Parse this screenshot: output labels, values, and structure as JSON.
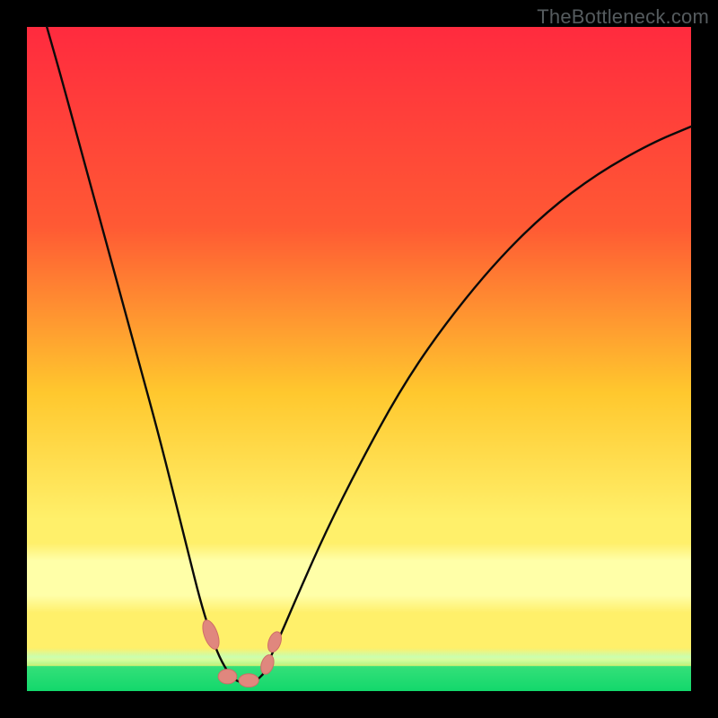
{
  "watermark": "TheBottleneck.com",
  "colors": {
    "black": "#000000",
    "curve": "#0a0a0a",
    "marker_fill": "#e0877e",
    "marker_stroke": "#cf6e67",
    "grad_top": "#ff2b3f",
    "grad_mid1": "#ff7a2e",
    "grad_mid2": "#ffc82e",
    "grad_mid3": "#fff06a",
    "grad_yellow_pale": "#ffffa8",
    "grad_green_pale": "#c8ffb0",
    "grad_green": "#35e07a",
    "grad_green_deep": "#13d86c"
  },
  "chart_data": {
    "type": "line",
    "title": "",
    "xlabel": "",
    "ylabel": "",
    "xlim": [
      0,
      100
    ],
    "ylim": [
      0,
      100
    ],
    "note": "Axes are implied percentage scales; values are read from curve pixel positions over the gradient background.",
    "series": [
      {
        "name": "left-branch",
        "x": [
          3,
          5,
          8,
          11,
          14,
          17,
          20,
          23,
          24.5,
          26,
          27.5,
          29,
          30.5
        ],
        "y": [
          100,
          93,
          82,
          71,
          60,
          49,
          38,
          26,
          20,
          14,
          9,
          5,
          2.5
        ]
      },
      {
        "name": "valley",
        "x": [
          30.5,
          31.5,
          33,
          34.5,
          35.5
        ],
        "y": [
          2.5,
          1.5,
          1.2,
          1.5,
          2.5
        ]
      },
      {
        "name": "right-branch",
        "x": [
          35.5,
          38,
          41,
          45,
          50,
          56,
          62,
          70,
          78,
          86,
          94,
          100
        ],
        "y": [
          2.5,
          8,
          15,
          24,
          34,
          45,
          54,
          64,
          72,
          78,
          82.5,
          85
        ]
      }
    ],
    "markers": [
      {
        "shape": "pill",
        "cx": 27.7,
        "cy": 8.5,
        "rx": 1.0,
        "ry": 2.3,
        "angle": -20
      },
      {
        "shape": "pill",
        "cx": 30.2,
        "cy": 2.2,
        "rx": 1.4,
        "ry": 1.1,
        "angle": 0
      },
      {
        "shape": "pill",
        "cx": 33.4,
        "cy": 1.6,
        "rx": 1.5,
        "ry": 1.0,
        "angle": 0
      },
      {
        "shape": "pill",
        "cx": 36.2,
        "cy": 4.0,
        "rx": 0.9,
        "ry": 1.5,
        "angle": 18
      },
      {
        "shape": "pill",
        "cx": 37.3,
        "cy": 7.4,
        "rx": 0.9,
        "ry": 1.6,
        "angle": 20
      }
    ]
  }
}
